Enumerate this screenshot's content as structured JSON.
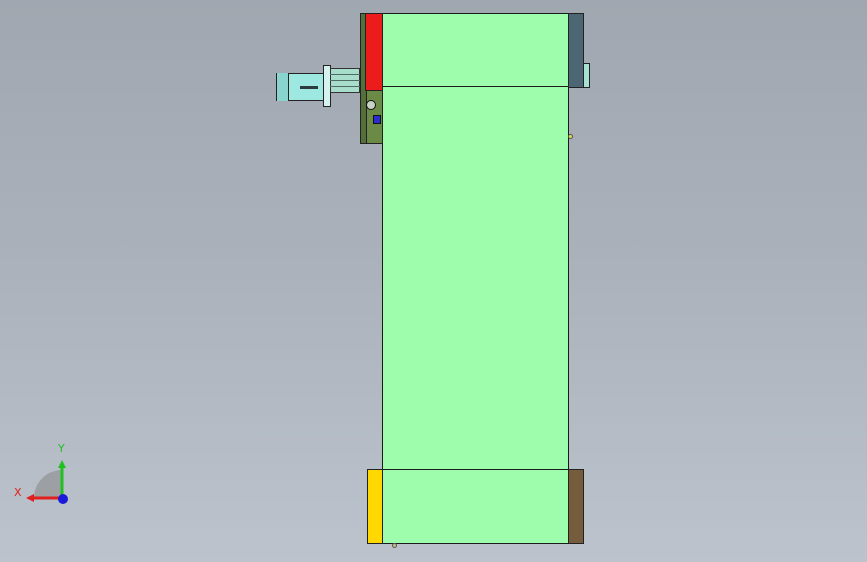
{
  "viewport": {
    "background_top": "#a0a7b0",
    "background_bottom": "#bcc3cc"
  },
  "model": {
    "belt_color": "#9efdac",
    "side_plate_colors": {
      "red": "#ec1c1c",
      "green_dark": "#546f3a",
      "green_mount": "#6a8a46",
      "grey_blue": "#4c6674",
      "yellow": "#ffd800",
      "brown": "#745c3c",
      "motor": "#9ee8e2",
      "sensor": "#2b2bd0"
    }
  },
  "triad": {
    "x_label": "X",
    "y_label": "Y",
    "x_color": "#e0201e",
    "y_color": "#20c020",
    "z_color": "#1a1ad8"
  }
}
